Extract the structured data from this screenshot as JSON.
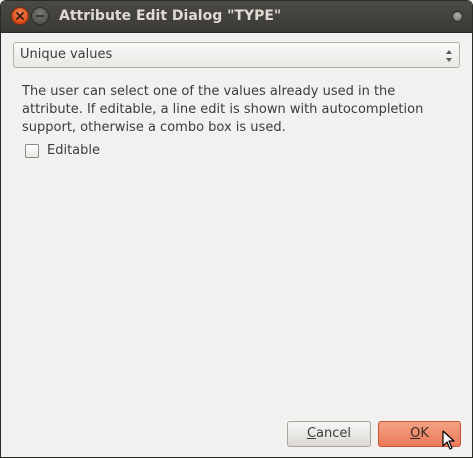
{
  "window": {
    "title": "Attribute Edit Dialog \"TYPE\""
  },
  "combo": {
    "value": "Unique values"
  },
  "description": "The user can select one of the values already used in the attribute. If editable, a line edit is shown with autocompletion support, otherwise a combo box is used.",
  "editable_checkbox": {
    "label": "Editable",
    "checked": false
  },
  "buttons": {
    "cancel_mnemonic": "C",
    "cancel_rest": "ancel",
    "ok_mnemonic": "O",
    "ok_rest": "K"
  },
  "icons": {
    "close": "close-icon",
    "minimize": "minimize-icon",
    "window_menu": "window-menu-icon",
    "combo_arrows": "updown-arrows-icon",
    "cursor": "mouse-pointer-icon"
  },
  "colors": {
    "titlebar": "#3c3b37",
    "accent_ok": "#ef7b5b",
    "close_button": "#e0561f",
    "background": "#f2f1f0"
  }
}
